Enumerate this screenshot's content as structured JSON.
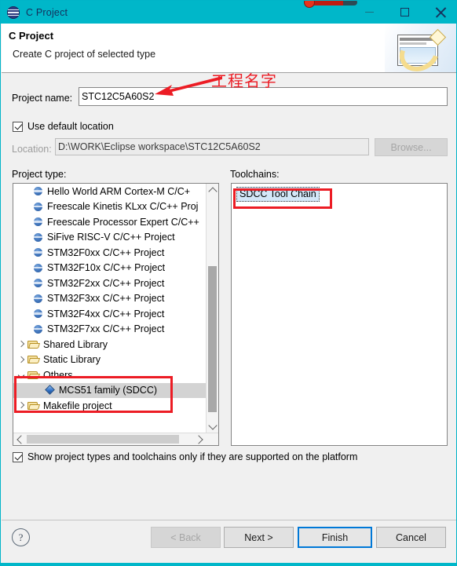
{
  "window": {
    "title": "C Project",
    "icon": "eclipse-icon",
    "controls": {
      "minimize": "minimize-icon",
      "maximize": "maximize-icon",
      "close": "close-icon"
    },
    "titlebar_color": "#00b7c9"
  },
  "header": {
    "title": "C Project",
    "subtitle": "Create C project of selected type",
    "banner_icon": "new-project-wizard-banner"
  },
  "annotation": {
    "text": "工程名字",
    "color": "#ec1c24",
    "arrow": "left-arrow-annotation"
  },
  "form": {
    "project_name_label": "Project name:",
    "project_name_value": "STC12C5A60S2",
    "use_default_location_label": "Use default location",
    "use_default_location_checked": true,
    "location_label": "Location:",
    "location_value": "D:\\WORK\\Eclipse workspace\\STC12C5A60S2",
    "browse_label": "Browse...",
    "browse_enabled": false
  },
  "project_type": {
    "label": "Project type:",
    "items": [
      {
        "text": "Hello World ARM Cortex-M C/C+",
        "icon": "project-disc-icon",
        "indent": 1,
        "twisty": "none",
        "selected": false
      },
      {
        "text": "Freescale Kinetis KLxx C/C++ Proj",
        "icon": "project-disc-icon",
        "indent": 1,
        "twisty": "none",
        "selected": false
      },
      {
        "text": "Freescale Processor Expert C/C++",
        "icon": "project-disc-icon",
        "indent": 1,
        "twisty": "none",
        "selected": false
      },
      {
        "text": "SiFive RISC-V C/C++ Project",
        "icon": "project-disc-icon",
        "indent": 1,
        "twisty": "none",
        "selected": false
      },
      {
        "text": "STM32F0xx C/C++ Project",
        "icon": "project-disc-icon",
        "indent": 1,
        "twisty": "none",
        "selected": false
      },
      {
        "text": "STM32F10x C/C++ Project",
        "icon": "project-disc-icon",
        "indent": 1,
        "twisty": "none",
        "selected": false
      },
      {
        "text": "STM32F2xx C/C++ Project",
        "icon": "project-disc-icon",
        "indent": 1,
        "twisty": "none",
        "selected": false
      },
      {
        "text": "STM32F3xx C/C++ Project",
        "icon": "project-disc-icon",
        "indent": 1,
        "twisty": "none",
        "selected": false
      },
      {
        "text": "STM32F4xx C/C++ Project",
        "icon": "project-disc-icon",
        "indent": 1,
        "twisty": "none",
        "selected": false
      },
      {
        "text": "STM32F7xx C/C++ Project",
        "icon": "project-disc-icon",
        "indent": 1,
        "twisty": "none",
        "selected": false
      },
      {
        "text": "Shared Library",
        "icon": "folder-icon",
        "indent": 0,
        "twisty": "collapsed",
        "selected": false
      },
      {
        "text": "Static Library",
        "icon": "folder-icon",
        "indent": 0,
        "twisty": "collapsed",
        "selected": false
      },
      {
        "text": "Others",
        "icon": "folder-icon",
        "indent": 0,
        "twisty": "expanded",
        "selected": false
      },
      {
        "text": "MCS51 family (SDCC)",
        "icon": "diamond-icon",
        "indent": 2,
        "twisty": "none",
        "selected": true
      },
      {
        "text": "Makefile project",
        "icon": "folder-icon",
        "indent": 0,
        "twisty": "collapsed",
        "selected": false
      }
    ]
  },
  "toolchains": {
    "label": "Toolchains:",
    "items": [
      {
        "text": "SDCC Tool Chain",
        "selected": true
      }
    ]
  },
  "platform_filter": {
    "label": "Show project types and toolchains only if they are supported on the platform",
    "checked": true
  },
  "footer": {
    "help": "?",
    "buttons": [
      {
        "label": "< Back",
        "state": "disabled"
      },
      {
        "label": "Next >",
        "state": "enabled"
      },
      {
        "label": "Finish",
        "state": "focused"
      },
      {
        "label": "Cancel",
        "state": "enabled"
      }
    ]
  }
}
